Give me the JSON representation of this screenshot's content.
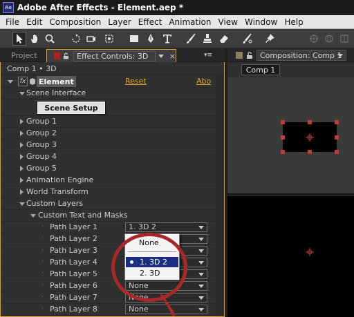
{
  "window": {
    "title": "Adobe After Effects - Element.aep *",
    "app_icon": "Ae"
  },
  "menu": [
    "File",
    "Edit",
    "Composition",
    "Layer",
    "Effect",
    "Animation",
    "View",
    "Window",
    "Help"
  ],
  "toolbar": {
    "tools": [
      "selection-tool-icon",
      "hand-tool-icon",
      "zoom-tool-icon",
      "rotation-tool-icon",
      "unified-camera-tool-icon",
      "pan-behind-tool-icon",
      "rectangle-tool-icon",
      "pen-tool-icon",
      "type-tool-icon",
      "brush-tool-icon",
      "clone-stamp-tool-icon",
      "eraser-tool-icon",
      "roto-brush-tool-icon",
      "puppet-pin-tool-icon"
    ]
  },
  "left_panel": {
    "tab_project": "Project",
    "tab_effect_controls": "Effect Controls: 3D",
    "breadcrumb": "Comp 1 • 3D",
    "effect": {
      "name": "Element",
      "reset": "Reset",
      "about": "Abo"
    },
    "scene_interface": "Scene Interface",
    "scene_setup_button": "Scene Setup",
    "groups": [
      "Group 1",
      "Group 2",
      "Group 3",
      "Group 4",
      "Group 5"
    ],
    "animation_engine": "Animation Engine",
    "world_transform": "World Transform",
    "custom_layers": "Custom Layers",
    "custom_text_masks": "Custom Text and Masks",
    "path_layers": [
      {
        "label": "Path Layer 1",
        "value": "1. 3D 2"
      },
      {
        "label": "Path Layer 2",
        "value": ""
      },
      {
        "label": "Path Layer 3",
        "value": ""
      },
      {
        "label": "Path Layer 4",
        "value": ""
      },
      {
        "label": "Path Layer 5",
        "value": ""
      },
      {
        "label": "Path Layer 6",
        "value": "None"
      },
      {
        "label": "Path Layer 7",
        "value": "None"
      },
      {
        "label": "Path Layer 8",
        "value": "None"
      }
    ],
    "popup": {
      "none": "None",
      "option1": "1. 3D 2",
      "option2": "2. 3D"
    }
  },
  "right_panel": {
    "tab_composition": "Composition: Comp 1",
    "comp_chip": "Comp 1"
  },
  "colors": {
    "accent_orange": "#e5a326",
    "highlight_red": "#a9282a",
    "menu_selection": "#1a2f83"
  }
}
